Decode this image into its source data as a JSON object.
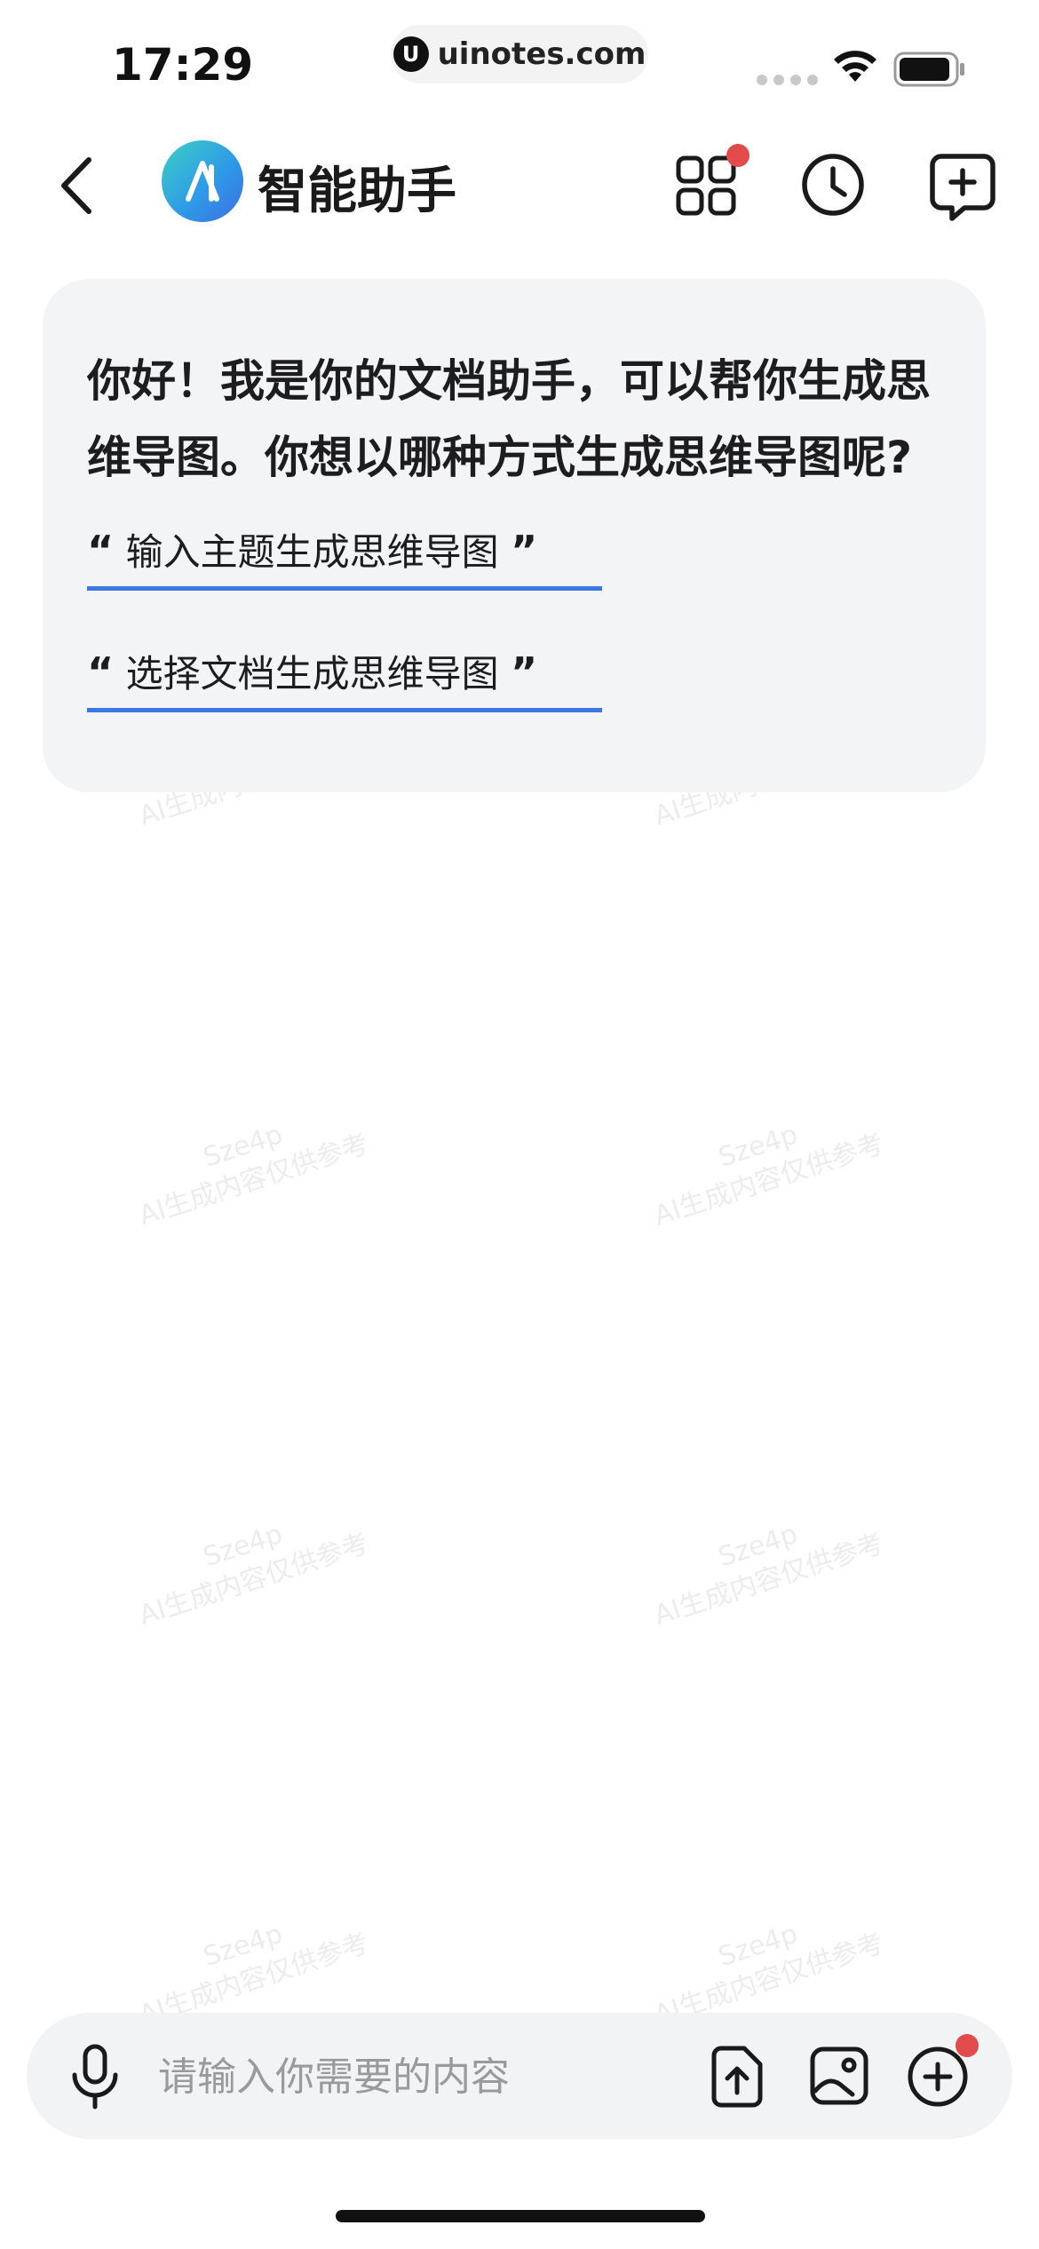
{
  "status_bar": {
    "time": "17:29",
    "url": "uinotes.com",
    "url_logo": "U"
  },
  "header": {
    "title": "智能助手",
    "logo_icon": "app-logo-icon",
    "back_icon": "chevron-left-icon",
    "apps_icon": "grid-icon",
    "history_icon": "clock-icon",
    "new_chat_icon": "new-chat-icon"
  },
  "message": {
    "text": "你好！我是你的文档助手，可以帮你生成思维导图。你想以哪种方式生成思维导图呢?",
    "suggestions": [
      {
        "open_quote": "“",
        "label": "输入主题生成思维导图",
        "close_quote": "”"
      },
      {
        "open_quote": "“",
        "label": "选择文档生成思维导图",
        "close_quote": "”"
      }
    ]
  },
  "watermark": {
    "line1": "Sze4p",
    "line2": "AI生成内容仅供参考"
  },
  "input_bar": {
    "placeholder": "请输入你需要的内容",
    "value": "",
    "mic_icon": "microphone-icon",
    "upload_icon": "upload-file-icon",
    "image_icon": "image-icon",
    "plus_icon": "plus-circle-icon"
  },
  "colors": {
    "accent": "#3d78e0",
    "badge": "#e14b4b",
    "card_bg": "#f3f4f6"
  }
}
